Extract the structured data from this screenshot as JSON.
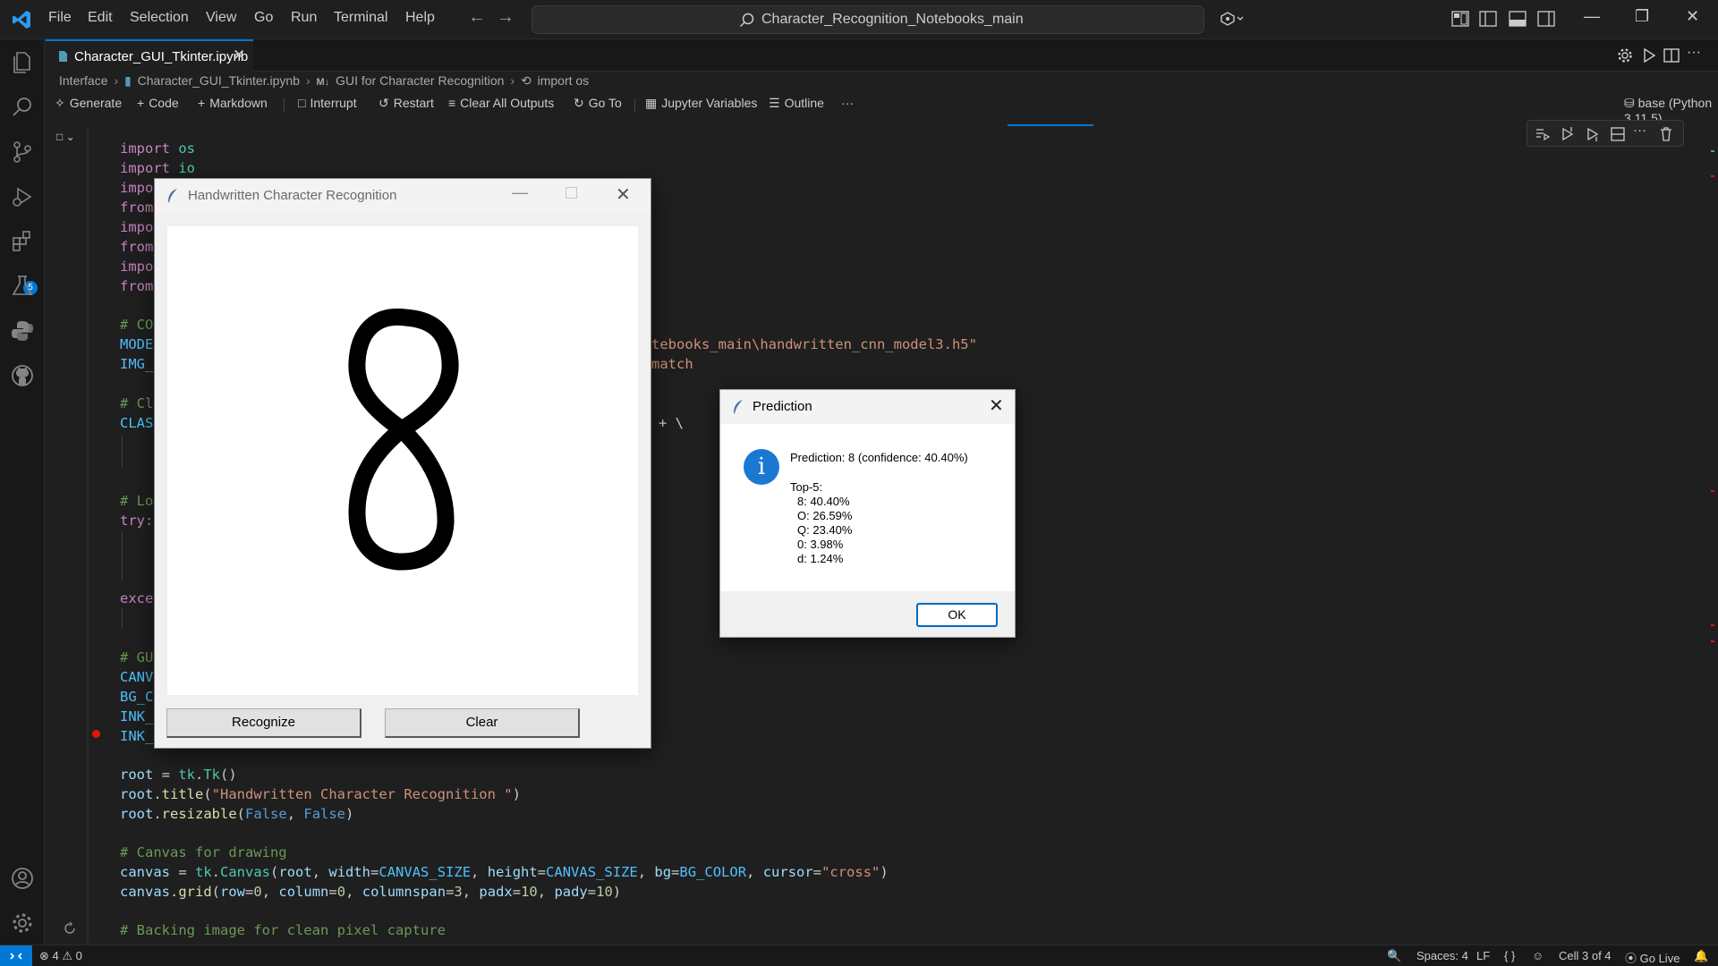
{
  "menu": [
    "File",
    "Edit",
    "Selection",
    "View",
    "Go",
    "Run",
    "Terminal",
    "Help"
  ],
  "search": {
    "text": "Character_Recognition_Notebooks_main"
  },
  "tab": {
    "label": "Character_GUI_Tkinter.ipynb"
  },
  "breadcrumb": [
    "Interface",
    "Character_GUI_Tkinter.ipynb",
    "GUI for Character Recognition",
    "import os"
  ],
  "toolbar": {
    "generate": "Generate",
    "code": "Code",
    "markdown": "Markdown",
    "interrupt": "Interrupt",
    "restart": "Restart",
    "clear_outputs": "Clear All Outputs",
    "goto": "Go To",
    "variables": "Jupyter Variables",
    "outline": "Outline",
    "more": "···",
    "kernel": "base (Python 3.11.5)"
  },
  "activity_badge": "5",
  "code": {
    "l1_kw": "import",
    "l1_mod": "os",
    "l2_kw": "import",
    "l2_mod": "io",
    "l3": "impo",
    "l4": "from",
    "l5": "impo",
    "l6": "from",
    "l7": "impo",
    "l8": "from",
    "l9": "# CO",
    "l10": "MODE",
    "l10_tail": "tebooks_main\\handwritten_cnn_model3.h5\"",
    "l11": "IMG_",
    "l11_tail": "match",
    "l12": "# Cl",
    "l13": "CLAS",
    "l13_tail": "+ \\",
    "l14": "# Lo",
    "l15": "try:",
    "l16": "exce",
    "l17": "# GU",
    "l18": "CANV",
    "l19": "BG_C",
    "l20": "INK_",
    "l21": "INK_",
    "l22_a": "root",
    "l22_b": " = ",
    "l22_c": "tk",
    "l22_d": ".",
    "l22_e": "Tk",
    "l22_f": "()",
    "l23_a": "root",
    "l23_b": ".",
    "l23_c": "title",
    "l23_d": "(",
    "l23_e": "\"Handwritten Character Recognition \"",
    "l23_f": ")",
    "l24_a": "root",
    "l24_b": ".",
    "l24_c": "resizable",
    "l24_d": "(",
    "l24_e": "False",
    "l24_f": ", ",
    "l24_g": "False",
    "l24_h": ")",
    "l25": "# Canvas for drawing",
    "l26_a": "canvas",
    "l26_b": " = ",
    "l26_c": "tk",
    "l26_d": ".",
    "l26_e": "Canvas",
    "l26_f": "(",
    "l26_g": "root",
    "l26_h": ", ",
    "l26_i": "width",
    "l26_j": "=",
    "l26_k": "CANVAS_SIZE",
    "l26_l": ", ",
    "l26_m": "height",
    "l26_n": "=",
    "l26_o": "CANVAS_SIZE",
    "l26_p": ", ",
    "l26_q": "bg",
    "l26_r": "=",
    "l26_s": "BG_COLOR",
    "l26_t": ", ",
    "l26_u": "cursor",
    "l26_v": "=",
    "l26_w": "\"cross\"",
    "l26_x": ")",
    "l27_a": "canvas",
    "l27_b": ".",
    "l27_c": "grid",
    "l27_d": "(",
    "l27_e": "row",
    "l27_f": "=",
    "l27_g": "0",
    "l27_h": ", ",
    "l27_i": "column",
    "l27_j": "=",
    "l27_k": "0",
    "l27_l": ", ",
    "l27_m": "columnspan",
    "l27_n": "=",
    "l27_o": "3",
    "l27_p": ", ",
    "l27_q": "padx",
    "l27_r": "=",
    "l27_s": "10",
    "l27_t": ", ",
    "l27_u": "pady",
    "l27_v": "=",
    "l27_w": "10",
    "l27_x": ")",
    "l28": "# Backing image for clean pixel capture"
  },
  "tk_window": {
    "title": "Handwritten Character Recognition",
    "recognize": "Recognize",
    "clear": "Clear"
  },
  "prediction": {
    "title": "Prediction",
    "headline": "Prediction: 8 (confidence: 40.40%)",
    "top_label": "Top-5:",
    "rows": [
      "8: 40.40%",
      "O: 26.59%",
      "Q: 23.40%",
      "0: 3.98%",
      "d: 1.24%"
    ],
    "ok": "OK"
  },
  "status": {
    "errors": "4",
    "warnings": "0",
    "spaces": "Spaces: 4",
    "eol": "LF",
    "braces": "{ }",
    "cell": "Cell 3 of 4",
    "golive": "Go Live"
  }
}
